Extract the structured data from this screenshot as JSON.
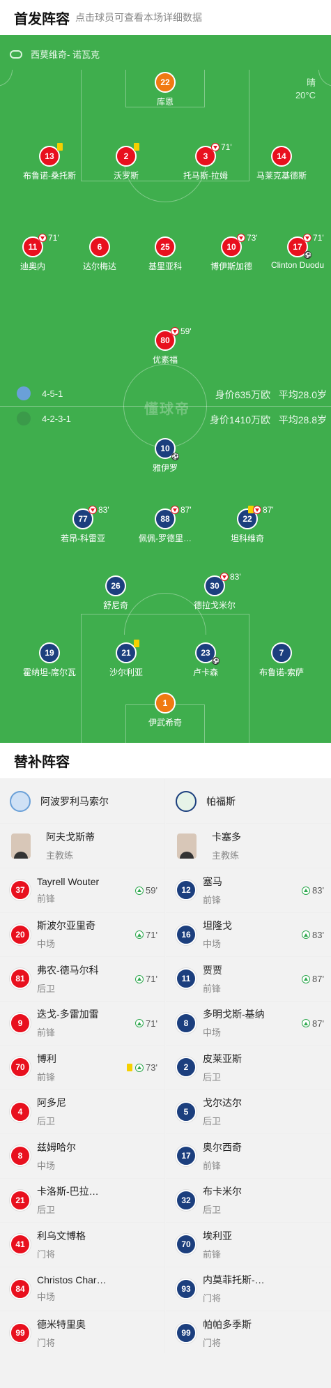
{
  "header": {
    "title": "首发阵容",
    "subtitle": "点击球员可查看本场详细数据"
  },
  "referee": "西莫维奇- 诺瓦克",
  "weather": {
    "condition": "晴",
    "temperature": "20°C"
  },
  "watermark": "懂球帝",
  "home_team": {
    "formation": "4-5-1",
    "value": "身价635万欧",
    "avg_age": "平均28.0岁",
    "badge_color": "#6aa0d8"
  },
  "away_team": {
    "formation": "4-2-3-1",
    "value": "身价1410万欧",
    "avg_age": "平均28.8岁",
    "badge_color": "#3b9a4a"
  },
  "home_players": [
    {
      "number": "22",
      "name": "库恩"
    },
    {
      "number": "13",
      "name": "布鲁诺-桑托斯"
    },
    {
      "number": "2",
      "name": "沃罗斯"
    },
    {
      "number": "3",
      "name": "托马斯-拉姆",
      "sub_min": "71'"
    },
    {
      "number": "14",
      "name": "马莱克基德斯"
    },
    {
      "number": "11",
      "name": "迪奥内",
      "sub_min": "71'"
    },
    {
      "number": "6",
      "name": "达尔梅达"
    },
    {
      "number": "25",
      "name": "基里亚科"
    },
    {
      "number": "10",
      "name": "博伊斯加德",
      "sub_min": "73'"
    },
    {
      "number": "17",
      "name": "Clinton Duodu",
      "sub_min": "71'"
    },
    {
      "number": "80",
      "name": "优素福",
      "sub_min": "59'"
    }
  ],
  "away_players": [
    {
      "number": "10",
      "name": "雅伊罗"
    },
    {
      "number": "77",
      "name": "若昂-科雷亚",
      "sub_min": "83'"
    },
    {
      "number": "88",
      "name": "佩佩-罗德里…",
      "sub_min": "87'"
    },
    {
      "number": "22",
      "name": "坦科维奇",
      "sub_min": "87'"
    },
    {
      "number": "26",
      "name": "舒尼奇"
    },
    {
      "number": "30",
      "name": "德拉戈米尔",
      "sub_min": "83'"
    },
    {
      "number": "19",
      "name": "霍纳坦-席尔瓦"
    },
    {
      "number": "21",
      "name": "沙尔利亚"
    },
    {
      "number": "23",
      "name": "卢卡森"
    },
    {
      "number": "7",
      "name": "布鲁诺-索萨"
    },
    {
      "number": "1",
      "name": "伊武希奇"
    }
  ],
  "subs": {
    "title": "替补阵容",
    "home": {
      "team_name": "阿波罗利马索尔",
      "coach": {
        "name": "阿夫戈斯蒂",
        "role": "主教练"
      },
      "players": [
        {
          "number": "37",
          "name": "Tayrell Wouter",
          "pos": "前锋",
          "in": "59'"
        },
        {
          "number": "20",
          "name": "斯波尔亚里奇",
          "pos": "中场",
          "in": "71'"
        },
        {
          "number": "81",
          "name": "弗农-德马尔科",
          "pos": "后卫",
          "in": "71'"
        },
        {
          "number": "9",
          "name": "迭戈-多雷加雷",
          "pos": "前锋",
          "in": "71'"
        },
        {
          "number": "70",
          "name": "博利",
          "pos": "前锋",
          "in": "73'"
        },
        {
          "number": "4",
          "name": "阿多尼",
          "pos": "后卫"
        },
        {
          "number": "8",
          "name": "兹姆哈尔",
          "pos": "中场"
        },
        {
          "number": "21",
          "name": "卡洛斯-巴拉…",
          "pos": "后卫"
        },
        {
          "number": "41",
          "name": "利乌文博格",
          "pos": "门将"
        },
        {
          "number": "84",
          "name": "Christos Char…",
          "pos": "中场"
        },
        {
          "number": "99",
          "name": "德米特里奥",
          "pos": "门将"
        }
      ]
    },
    "away": {
      "team_name": "帕福斯",
      "coach": {
        "name": "卡塞多",
        "role": "主教练"
      },
      "players": [
        {
          "number": "12",
          "name": "塞马",
          "pos": "前锋",
          "in": "83'"
        },
        {
          "number": "16",
          "name": "坦隆戈",
          "pos": "中场",
          "in": "83'"
        },
        {
          "number": "11",
          "name": "贾贾",
          "pos": "前锋",
          "in": "87'"
        },
        {
          "number": "8",
          "name": "多明戈斯-基纳",
          "pos": "中场",
          "in": "87'"
        },
        {
          "number": "2",
          "name": "皮莱亚斯",
          "pos": "后卫"
        },
        {
          "number": "5",
          "name": "戈尔达尔",
          "pos": "后卫"
        },
        {
          "number": "17",
          "name": "奥尔西奇",
          "pos": "前锋"
        },
        {
          "number": "32",
          "name": "布卡米尔",
          "pos": "后卫"
        },
        {
          "number": "70",
          "name": "埃利亚",
          "pos": "前锋"
        },
        {
          "number": "93",
          "name": "内莫菲托斯-…",
          "pos": "门将"
        },
        {
          "number": "99",
          "name": "帕帕多季斯",
          "pos": "门将"
        }
      ]
    }
  }
}
